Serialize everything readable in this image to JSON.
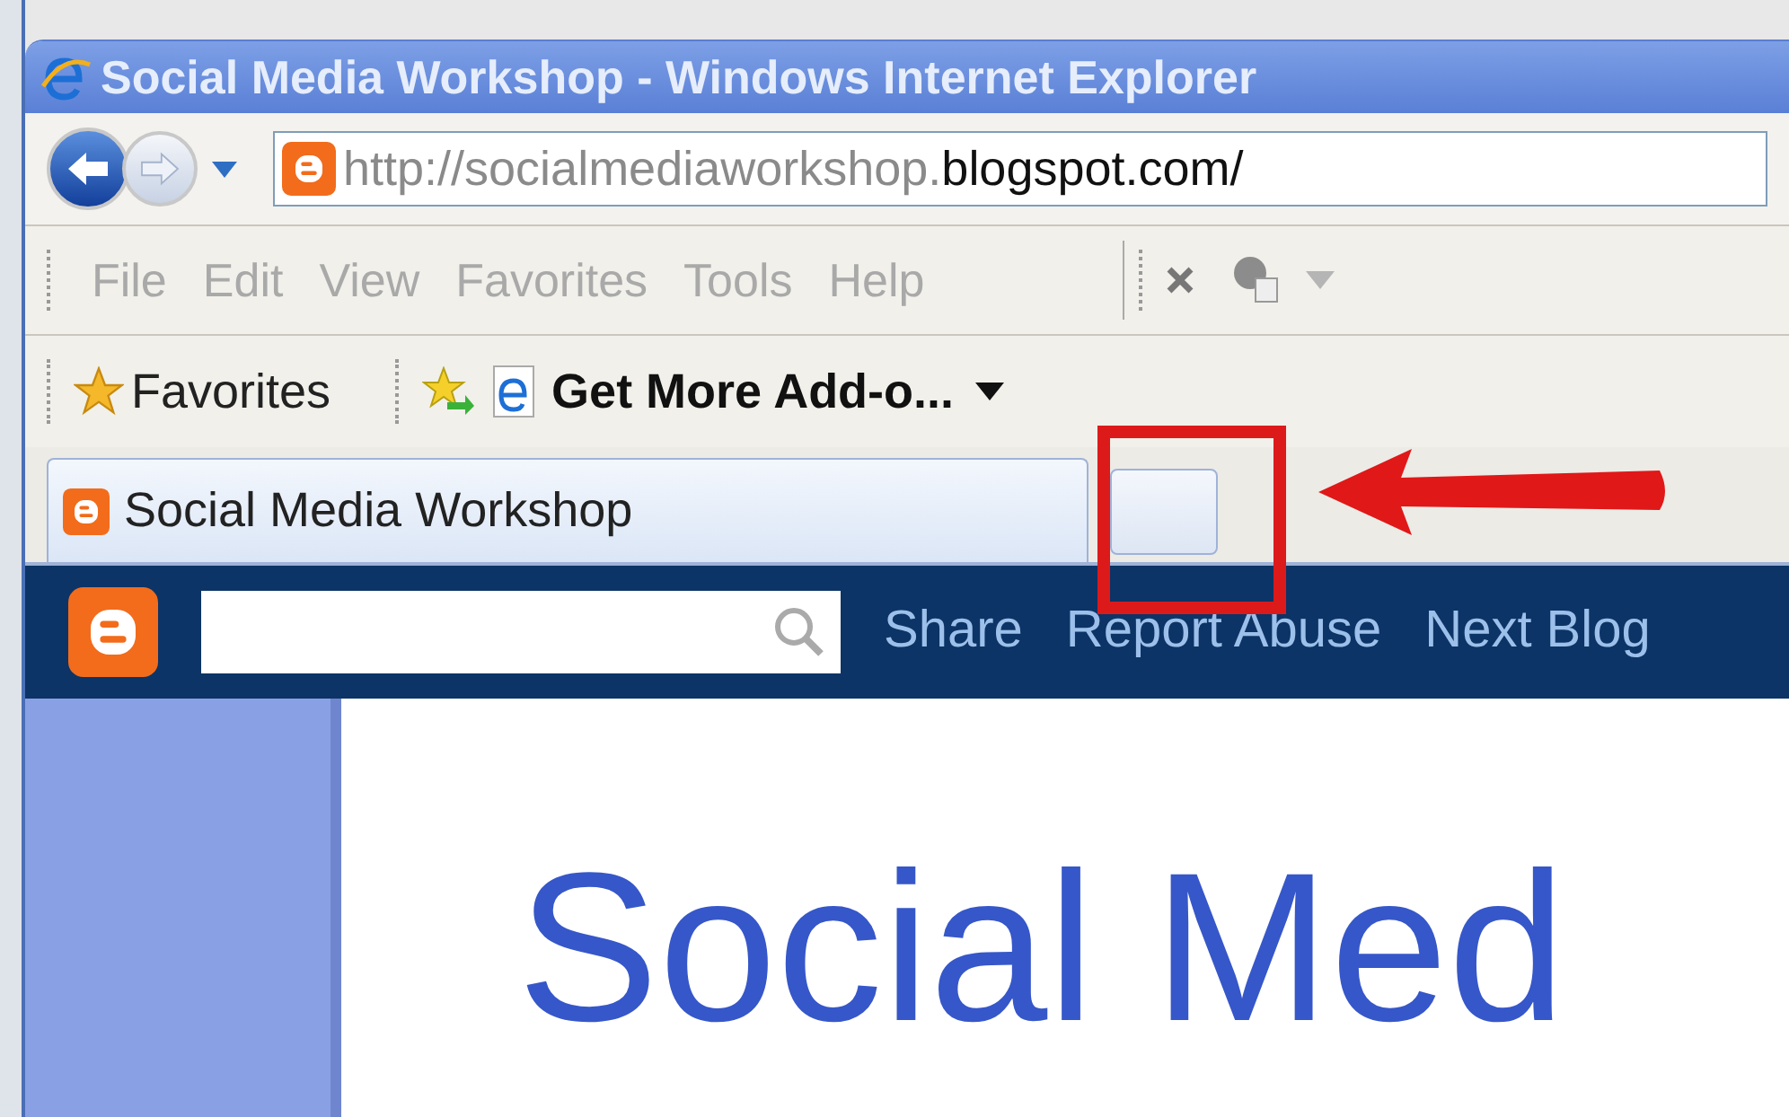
{
  "window": {
    "title": "Social Media Workshop - Windows Internet Explorer"
  },
  "address_bar": {
    "url_prefix": "http://socialmediaworkshop.",
    "url_domain": "blogspot.com/"
  },
  "menu": [
    "File",
    "Edit",
    "View",
    "Favorites",
    "Tools",
    "Help"
  ],
  "favorites_bar": {
    "favorites": "Favorites",
    "addons": "Get More Add-o..."
  },
  "tabs": [
    {
      "label": "Social Media Workshop",
      "selected": true
    }
  ],
  "blogger_bar": {
    "links": [
      "Share",
      "Report Abuse",
      "Next Blog"
    ]
  },
  "page": {
    "heading": "Social Med"
  }
}
